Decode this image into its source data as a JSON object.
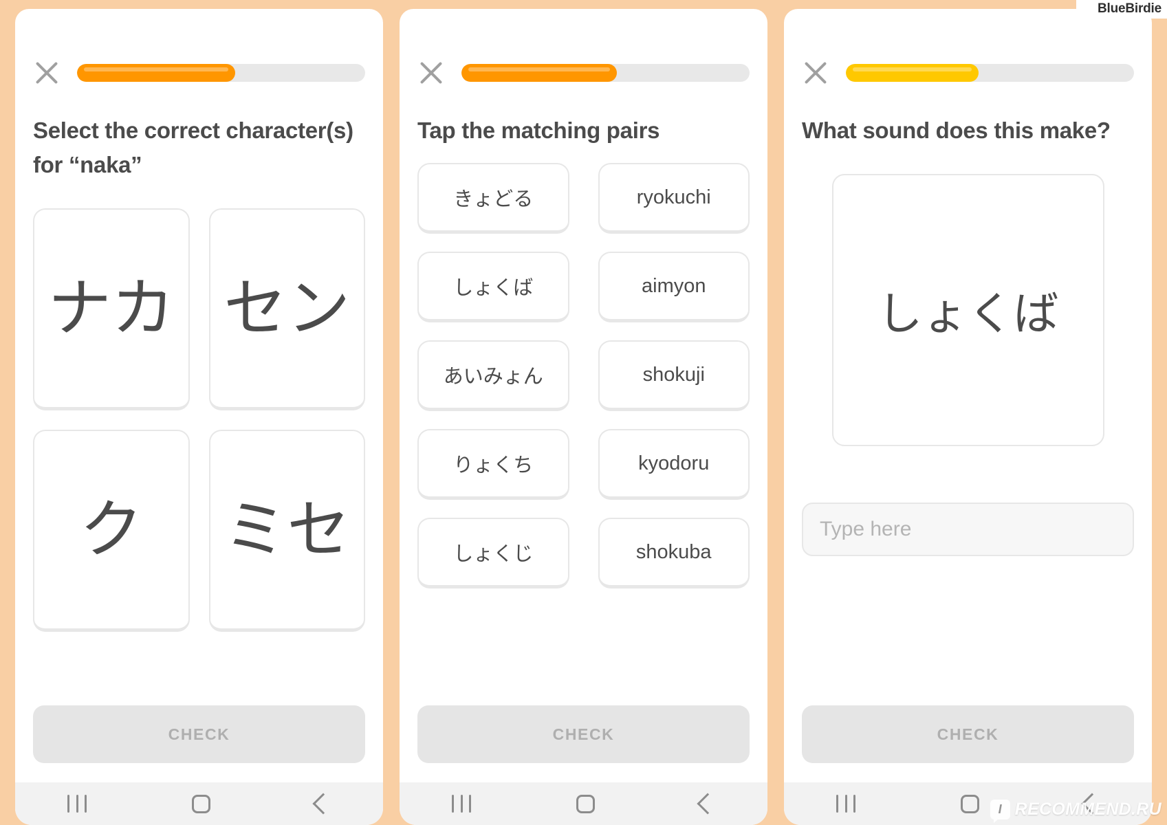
{
  "watermarks": {
    "top_right": "BlueBirdie",
    "bottom_right": "RECOMMEND.RU",
    "bottom_right_logo": "I"
  },
  "theme": {
    "background": "#f9cfa4",
    "progress_orange": "#ff9600",
    "progress_yellow": "#ffc800",
    "track_gray": "#e8e8e8",
    "text_gray": "#4b4b4b",
    "button_gray": "#e5e5e5",
    "button_text_gray": "#afafaf"
  },
  "screens": [
    {
      "id": "select-character",
      "close_label": "×",
      "progress": {
        "percent": 55,
        "color": "#ff9600"
      },
      "prompt": "Select the correct character(s) for “naka”",
      "tiles": [
        {
          "label": "ナカ"
        },
        {
          "label": "セン"
        },
        {
          "label": "ク"
        },
        {
          "label": "ミセ"
        }
      ],
      "check_label": "CHECK",
      "navbar": {
        "recents": "recents",
        "home": "home",
        "back": "back"
      }
    },
    {
      "id": "matching-pairs",
      "close_label": "×",
      "progress": {
        "percent": 54,
        "color": "#ff9600"
      },
      "prompt": "Tap the matching pairs",
      "pairs": [
        {
          "left": "きょどる",
          "right": "ryokuchi"
        },
        {
          "left": "しょくば",
          "right": "aimyon"
        },
        {
          "left": "あいみょん",
          "right": "shokuji"
        },
        {
          "left": "りょくち",
          "right": "kyodoru"
        },
        {
          "left": "しょくじ",
          "right": "shokuba"
        }
      ],
      "check_label": "CHECK",
      "navbar": {
        "recents": "recents",
        "home": "home",
        "back": "back"
      }
    },
    {
      "id": "what-sound",
      "close_label": "×",
      "progress": {
        "percent": 46,
        "color": "#ffc800"
      },
      "prompt": "What sound does this make?",
      "sound_card": "しょくば",
      "input": {
        "value": "",
        "placeholder": "Type here"
      },
      "check_label": "CHECK",
      "navbar": {
        "recents": "recents",
        "home": "home",
        "back": "back"
      }
    }
  ]
}
